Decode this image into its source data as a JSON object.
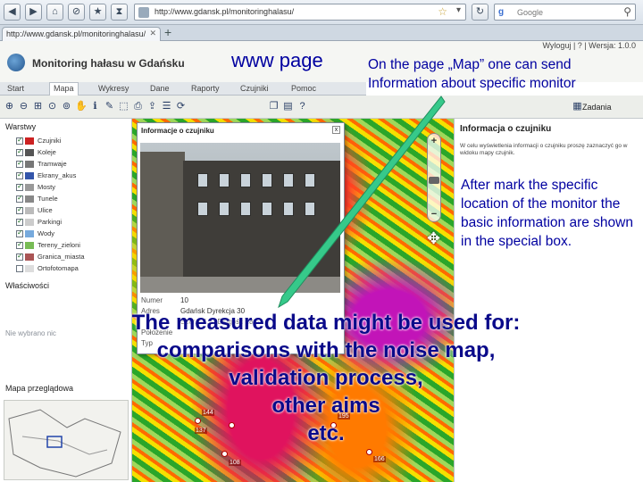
{
  "browser": {
    "url": "http://www.gdansk.pl/monitoringhalasu/",
    "search_engine": "g",
    "search_placeholder": "Google",
    "tab_title": "http://www.gdansk.pl/monitoringhalasu/",
    "new_tab": "+"
  },
  "app": {
    "title": "Monitoring hałasu w Gdańsku",
    "header_links": "Wyloguj  |  ?  |  Wersja: 1.0.0"
  },
  "nav": {
    "tabs": [
      "Start",
      "Mapa",
      "Wykresy",
      "Dane",
      "Raporty",
      "Czujniki",
      "Pomoc"
    ],
    "active": "Mapa"
  },
  "toolbar": {
    "zadania_label": "Zadania",
    "tools": [
      "zoom-in",
      "zoom-out",
      "zoom-extent",
      "zoom-prev",
      "zoom-next",
      "pan",
      "identify",
      "measure",
      "select",
      "print",
      "export",
      "info",
      "refresh",
      "layers",
      "legend",
      "help"
    ]
  },
  "left_panel": {
    "layers_heading": "Warstwy",
    "layers": [
      {
        "label": "Czujniki",
        "checked": true,
        "color": "#cc2222"
      },
      {
        "label": "Koleje",
        "checked": true,
        "color": "#555555"
      },
      {
        "label": "Tramwaje",
        "checked": true,
        "color": "#777777"
      },
      {
        "label": "Ekrany_akus",
        "checked": true,
        "color": "#3355aa"
      },
      {
        "label": "Mosty",
        "checked": true,
        "color": "#999999"
      },
      {
        "label": "Tunele",
        "checked": true,
        "color": "#888888"
      },
      {
        "label": "Ulice",
        "checked": true,
        "color": "#bbbbbb"
      },
      {
        "label": "Parkingi",
        "checked": true,
        "color": "#cccccc"
      },
      {
        "label": "Wody",
        "checked": true,
        "color": "#77aadd"
      },
      {
        "label": "Tereny_zieloni",
        "checked": true,
        "color": "#77bb55"
      },
      {
        "label": "Granica_miasta",
        "checked": true,
        "color": "#aa5555"
      },
      {
        "label": "Ortofotomapa",
        "checked": false,
        "color": "#dddddd"
      }
    ],
    "properties_heading": "Właściwości",
    "no_selection": "Nie wybrano nic",
    "overview_heading": "Mapa przeglądowa"
  },
  "popup": {
    "title": "Informacje o czujniku",
    "close": "x",
    "fields": [
      {
        "label": "Numer",
        "value": "10"
      },
      {
        "label": "Adres",
        "value": "Gdańsk Dyrekcja 30"
      },
      {
        "label": "",
        "value": "Szer. 54.3°  Długość 18.6°"
      },
      {
        "label": "Położenie",
        "value": ""
      },
      {
        "label": "Typ",
        "value": ""
      }
    ]
  },
  "right_panel": {
    "title": "Informacja o czujniku",
    "desc": "W celu wyświetlenia informacji o czujniku proszę zaznaczyć go w widoku mapy czujnik."
  },
  "map": {
    "numbers": [
      "144",
      "137",
      "195",
      "108",
      "166"
    ]
  },
  "annotations": {
    "www_page": "www page",
    "map_note_line1": "On the page „Map” one can send",
    "map_note_line2": "Information about specific monitor",
    "after_mark": "After mark the specific location of the monitor the basic information are shown in the special box.",
    "measured_line1": "The measured data might be used for:",
    "measured_line2": "comparisons with the noise map,",
    "measured_line3": "validation process,",
    "measured_line4": "other aims",
    "measured_line5": "etc."
  },
  "colors": {
    "annotation": "#0000a0",
    "arrow": "#36c98a"
  }
}
